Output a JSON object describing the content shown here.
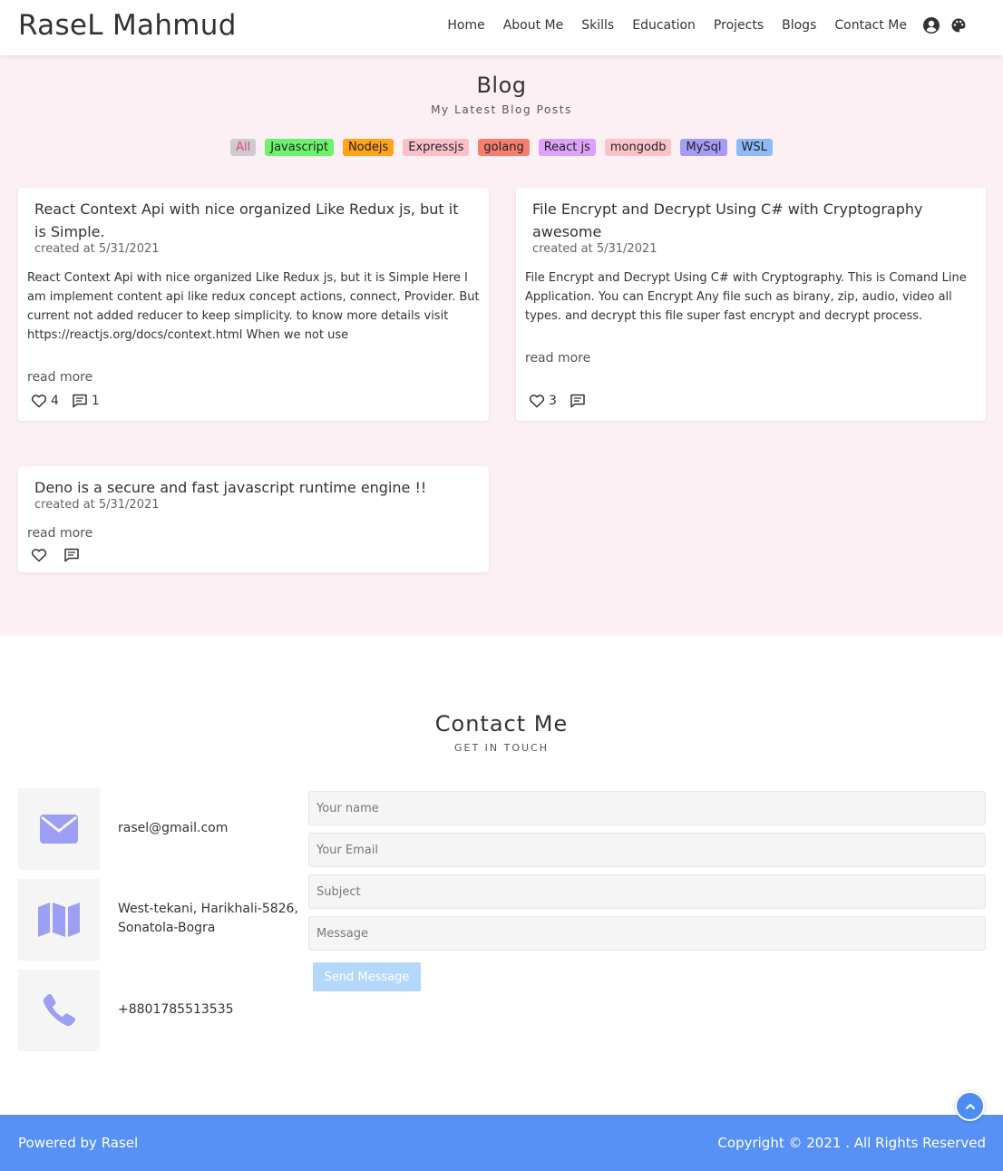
{
  "header": {
    "brand": "RaseL Mahmud",
    "nav": [
      "Home",
      "About Me",
      "Skills",
      "Education",
      "Projects",
      "Blogs",
      "Contact Me"
    ],
    "icons": [
      "user-circle-icon",
      "palette-icon"
    ]
  },
  "blog": {
    "title": "Blog",
    "subtitle": "My Latest Blog Posts",
    "tags": [
      {
        "label": "All",
        "bg": "#cccccc",
        "color": "#e83e8c"
      },
      {
        "label": "Javascript",
        "bg": "#6bf36b",
        "color": "#222222"
      },
      {
        "label": "Nodejs",
        "bg": "#ffa41a",
        "color": "#222222"
      },
      {
        "label": "Expressjs",
        "bg": "#f9c0c9",
        "color": "#222222"
      },
      {
        "label": "golang",
        "bg": "#f67e6e",
        "color": "#222222"
      },
      {
        "label": "React js",
        "bg": "#dea1f8",
        "color": "#222222"
      },
      {
        "label": "mongodb",
        "bg": "#fac3ca",
        "color": "#222222"
      },
      {
        "label": "MySql",
        "bg": "#a49cf6",
        "color": "#222222"
      },
      {
        "label": "WSL",
        "bg": "#8db9f8",
        "color": "#222222"
      }
    ],
    "posts": [
      {
        "title": "React Context Api with nice organized Like Redux js, but it is Simple.",
        "date": "created at 5/31/2021",
        "body": "React Context Api with nice organized Like Redux js, but it is Simple Here I am implement content api like redux concept actions, connect, Provider. But current not added reducer to keep simplicity. to know more details visit https://reactjs.org/docs/context.html When we not use",
        "read_more": "read more",
        "likes": "4",
        "comments": "1"
      },
      {
        "title": "File Encrypt and Decrypt Using C# with Cryptography awesome",
        "date": "created at 5/31/2021",
        "body": "File Encrypt and Decrypt Using C# with Cryptography. This is Comand Line Application. You can Encrypt Any file such as birany, zip, audio, video all types. and decrypt this file super fast encrypt and decrypt process.",
        "read_more": "read more",
        "likes": "3",
        "comments": ""
      },
      {
        "title": "Deno is a secure and fast javascript runtime engine !!",
        "date": "created at 5/31/2021",
        "body": "",
        "read_more": "read more",
        "likes": "",
        "comments": ""
      }
    ]
  },
  "contact": {
    "title": "Contact Me",
    "subtitle": "GET IN TOUCH",
    "accent": "#9c9ff4",
    "info": [
      {
        "icon": "envelope-icon",
        "text": "rasel@gmail.com"
      },
      {
        "icon": "map-icon",
        "text": "West-tekani, Harikhali-5826, Sonatola-Bogra"
      },
      {
        "icon": "phone-icon",
        "text": "+8801785513535"
      }
    ],
    "form": {
      "name_placeholder": "Your name",
      "email_placeholder": "Your Email",
      "subject_placeholder": "Subject",
      "message_placeholder": "Message",
      "send_label": "Send Message"
    }
  },
  "footer": {
    "left": "Powered by Rasel",
    "right": "Copyright © 2021 . All Rights Reserved",
    "bg": "#5891f5"
  }
}
